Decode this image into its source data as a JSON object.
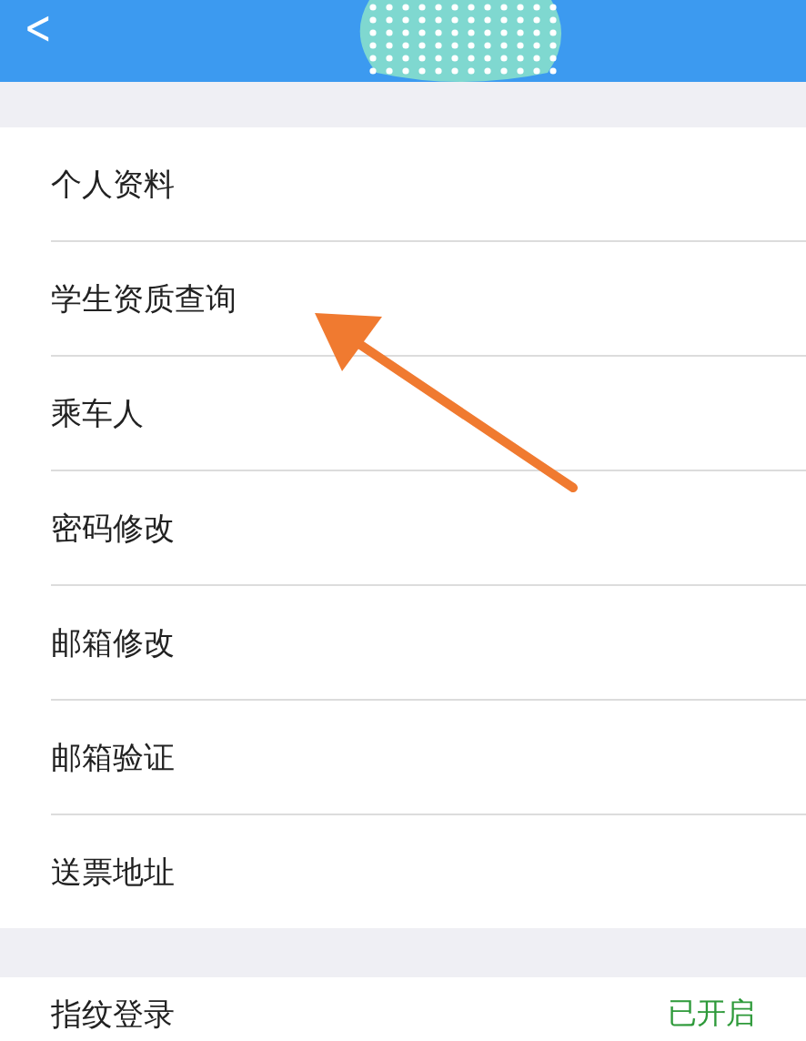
{
  "header": {
    "back": "<"
  },
  "menu": [
    {
      "label": "个人资料"
    },
    {
      "label": "学生资质查询"
    },
    {
      "label": "乘车人"
    },
    {
      "label": "密码修改"
    },
    {
      "label": "邮箱修改"
    },
    {
      "label": "邮箱验证"
    },
    {
      "label": "送票地址"
    }
  ],
  "settings": [
    {
      "label": "指纹登录",
      "value": "已开启"
    }
  ]
}
